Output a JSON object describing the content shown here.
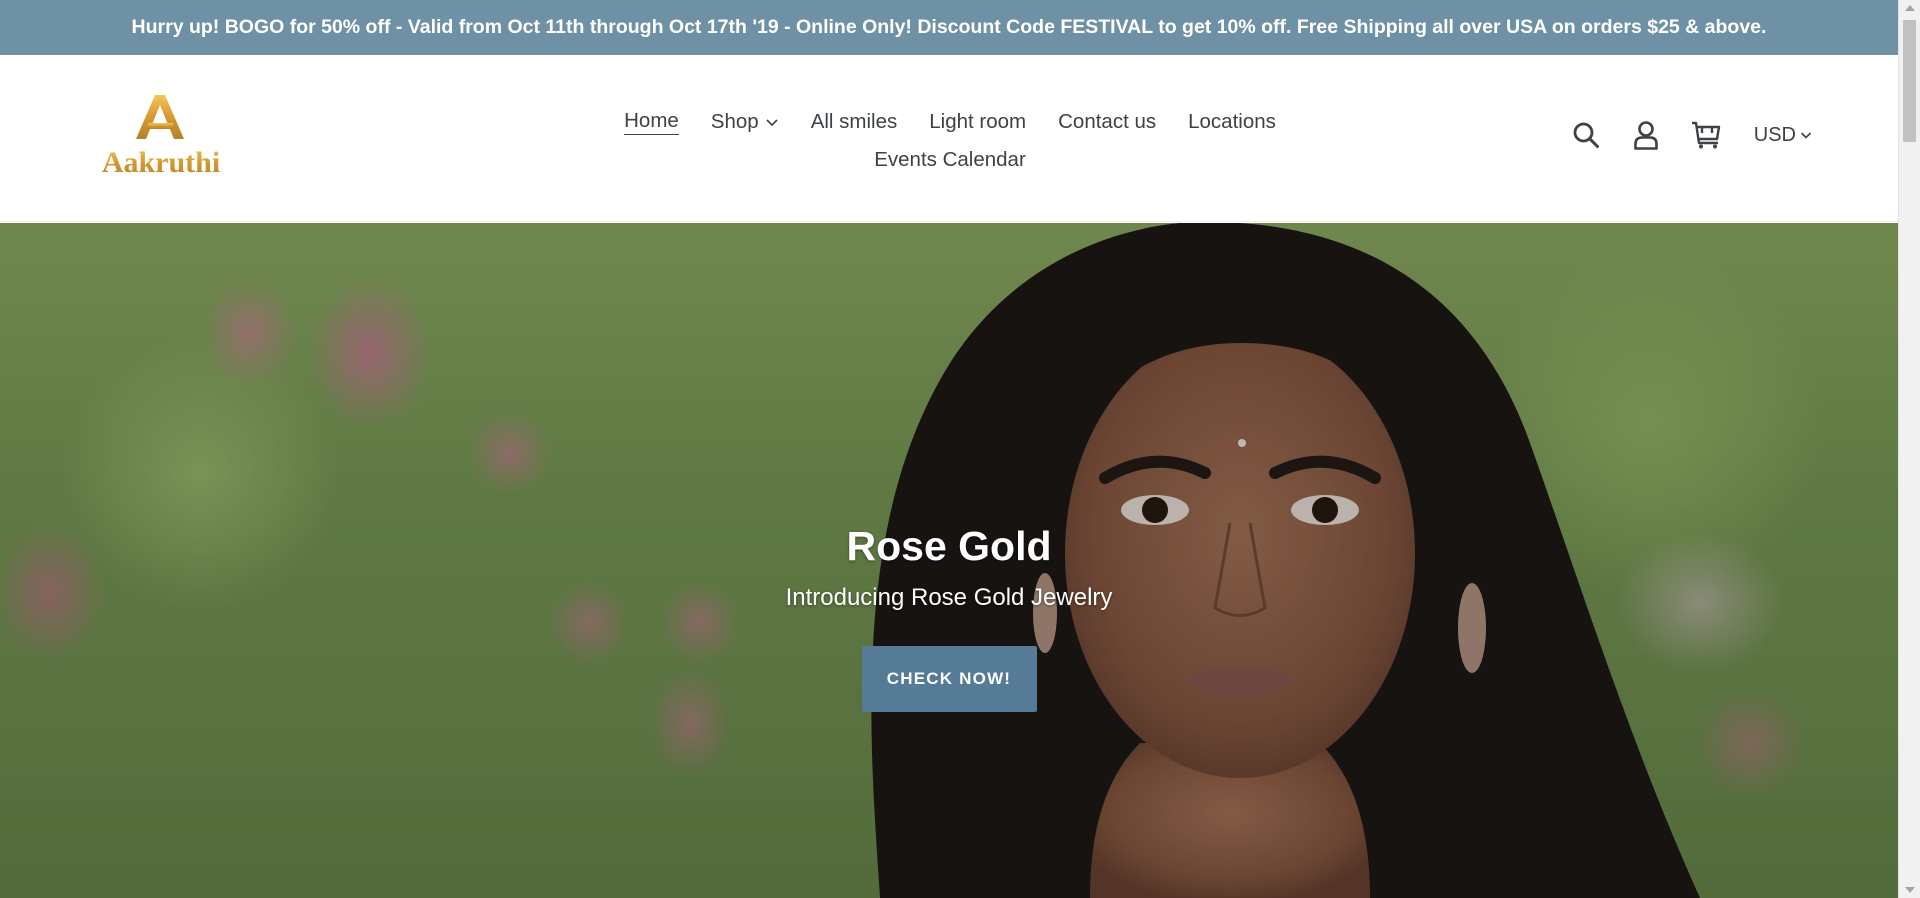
{
  "announcement": {
    "text": "Hurry up! BOGO for 50% off - Valid from Oct 11th through Oct 17th '19 - Online Only! Discount Code FESTIVAL to get 10% off. Free Shipping all over USA on orders $25 & above."
  },
  "header": {
    "logo_text": "Aakruthi",
    "nav": {
      "row1": [
        {
          "label": "Home",
          "active": true
        },
        {
          "label": "Shop",
          "has_dropdown": true
        },
        {
          "label": "All smiles"
        },
        {
          "label": "Light room"
        },
        {
          "label": "Contact us"
        },
        {
          "label": "Locations"
        }
      ],
      "row2": [
        {
          "label": "Events Calendar"
        }
      ]
    },
    "icons": [
      "search-icon",
      "account-icon",
      "cart-icon"
    ],
    "currency": "USD"
  },
  "hero": {
    "title": "Rose Gold",
    "subtitle": "Introducing Rose Gold Jewelry",
    "button_label": "CHECK NOW!"
  },
  "colors": {
    "announcement_bg": "#6f91a5",
    "button_bg": "#557b97",
    "logo_gold": "#d4a23a",
    "text": "#3d4246"
  }
}
